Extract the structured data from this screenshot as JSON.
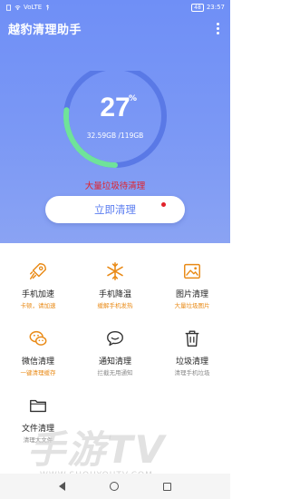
{
  "status_bar": {
    "network_text": "VoLTE",
    "battery": "48",
    "time": "23:57"
  },
  "header": {
    "app_title": "越豹清理助手"
  },
  "gauge": {
    "percent": "27",
    "percent_sign": "%",
    "usage_text": "32.59GB /119GB",
    "fill_fraction": 0.27
  },
  "junk_message": "大量垃圾待清理",
  "clean_button_label": "立即清理",
  "colors": {
    "accent": "#6f8ff6",
    "gauge_fill": "#6fe39a",
    "warning_red": "#e1222a",
    "icon_orange": "#e98a16"
  },
  "features": [
    {
      "label": "手机加速",
      "sub": "卡顿，请加速",
      "sub_style": "orange",
      "icon": "rocket-icon"
    },
    {
      "label": "手机降温",
      "sub": "缓解手机发热",
      "sub_style": "orange",
      "icon": "snowflake-icon"
    },
    {
      "label": "图片清理",
      "sub": "大量垃圾图片",
      "sub_style": "orange",
      "icon": "image-icon"
    },
    {
      "label": "微信清理",
      "sub": "一键清理缓存",
      "sub_style": "orange",
      "icon": "wechat-icon"
    },
    {
      "label": "通知清理",
      "sub": "拦截无用通知",
      "sub_style": "gray",
      "icon": "message-bubble-icon"
    },
    {
      "label": "垃圾清理",
      "sub": "清理手机垃圾",
      "sub_style": "gray",
      "icon": "trash-icon"
    },
    {
      "label": "文件清理",
      "sub": "清理大文件",
      "sub_style": "gray",
      "icon": "folder-icon"
    }
  ],
  "watermark": {
    "big": "手游TV",
    "small": "WWW.SHOUYOUTV.COM"
  }
}
